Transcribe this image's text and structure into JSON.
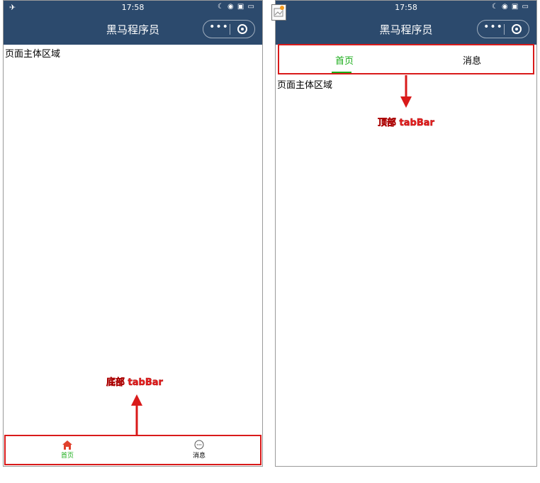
{
  "status_bar": {
    "time": "17:58",
    "left_icons": "✈ ",
    "right_icons": "☾ ◉ ▣ ▭"
  },
  "nav": {
    "title": "黑马程序员",
    "more_label": "•••"
  },
  "left_phone": {
    "body_text": "页面主体区域",
    "tabbar": [
      {
        "label": "首页",
        "icon": "home-icon"
      },
      {
        "label": "消息",
        "icon": "message-icon"
      }
    ]
  },
  "right_phone": {
    "body_text": "页面主体区域",
    "tabbar": [
      {
        "label": "首页"
      },
      {
        "label": "消息"
      }
    ]
  },
  "annotations": {
    "bottom_tabbar": "底部 tabBar",
    "top_tabbar": "顶部 tabBar"
  },
  "colors": {
    "header_bg": "#2c4a6d",
    "accent": "#1aad19",
    "highlight": "#d91a1a"
  }
}
